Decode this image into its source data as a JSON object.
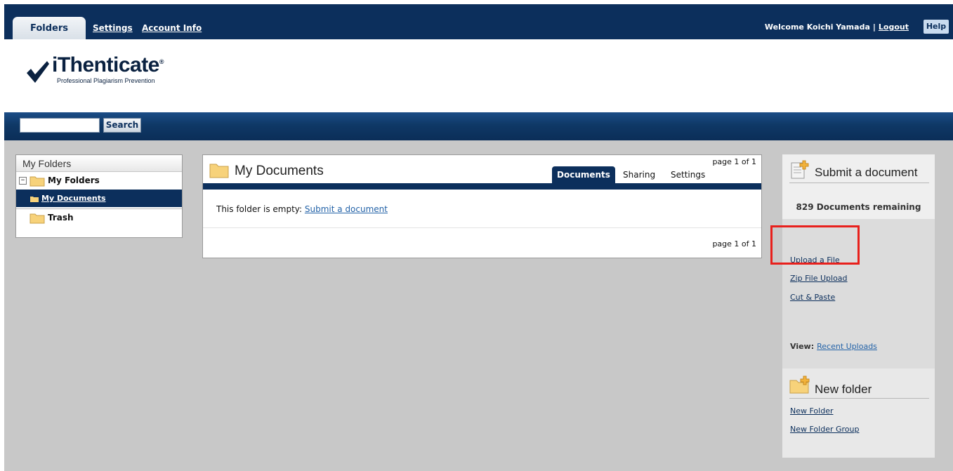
{
  "topnav": {
    "tabs": [
      "Folders",
      "Settings",
      "Account Info"
    ],
    "welcome": "Welcome Koichi Yamada",
    "separator": "|",
    "logout": "Logout",
    "help": "Help"
  },
  "logo": {
    "brand": "iThenticate",
    "tagline": "Professional Plagiarism Prevention"
  },
  "search": {
    "value": "",
    "button": "Search"
  },
  "folders": {
    "header": "My Folders",
    "group": "My Folders",
    "items": [
      "My Documents",
      "Trash"
    ]
  },
  "documents": {
    "title": "My Documents",
    "pager": "page 1 of 1",
    "tabs": [
      "Documents",
      "Sharing",
      "Settings"
    ],
    "empty_text": "This folder is empty:",
    "empty_link": "Submit a document"
  },
  "submit": {
    "title": "Submit a document",
    "remaining": "829 Documents remaining",
    "links": [
      "Upload a File",
      "Zip File Upload",
      "Cut & Paste"
    ],
    "view_label": "View:",
    "view_link": "Recent Uploads"
  },
  "newfolder": {
    "title": "New folder",
    "links": [
      "New Folder",
      "New Folder Group"
    ]
  },
  "colors": {
    "navy": "#0c2f5c",
    "highlight": "#e8201c",
    "folder": "#f7d27a"
  }
}
